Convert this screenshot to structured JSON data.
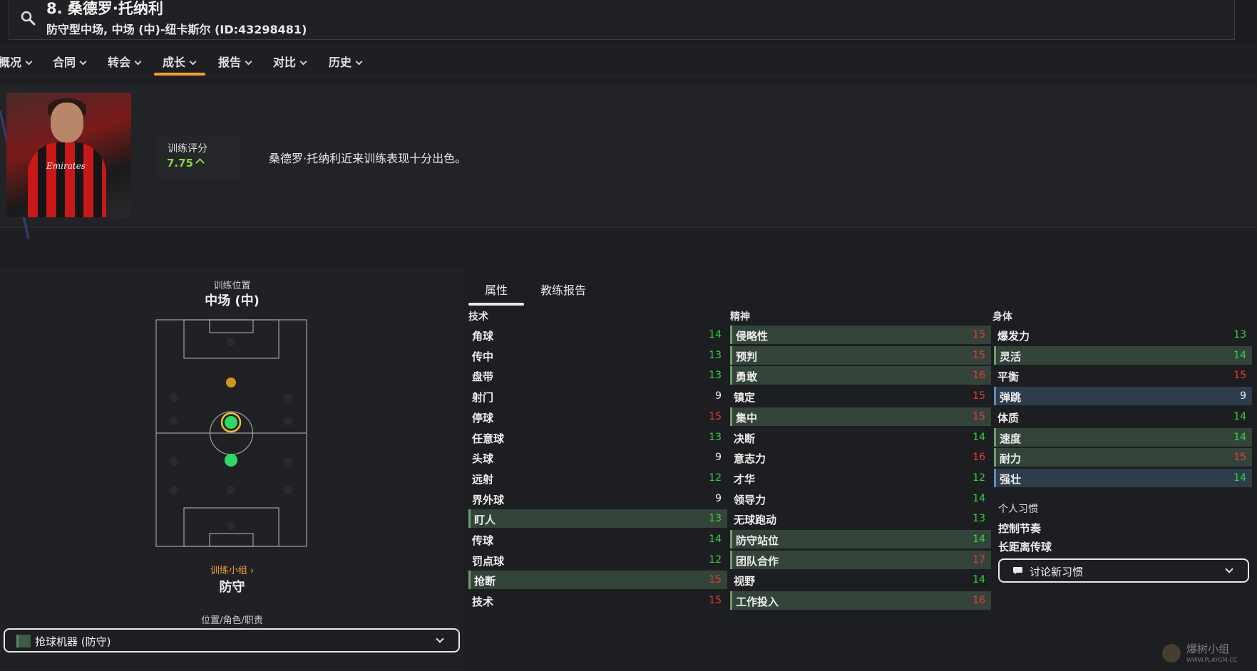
{
  "header": {
    "player_name": "8. 桑德罗·托纳利",
    "player_sub": "防守型中场, 中场 (中)-纽卡斯尔 (ID:43298481)"
  },
  "nav": {
    "tabs": [
      {
        "label": "概况"
      },
      {
        "label": "合同"
      },
      {
        "label": "转会"
      },
      {
        "label": "成长",
        "active": true
      },
      {
        "label": "报告"
      },
      {
        "label": "对比"
      },
      {
        "label": "历史"
      }
    ]
  },
  "training": {
    "photo_sponsor": "Emirates",
    "rating_label": "训练评分",
    "rating_value": "7.75",
    "comment": "桑德罗·托纳利近来训练表现十分出色。"
  },
  "position": {
    "label": "训练位置",
    "value": "中场 (中)",
    "group_link": "训练小组",
    "group_value": "防守",
    "role_label": "位置/角色/职责",
    "role_value": "抢球机器 (防守)"
  },
  "attr_tabs": [
    {
      "label": "属性",
      "active": true
    },
    {
      "label": "教练报告"
    }
  ],
  "attributes": {
    "technical": {
      "title": "技术",
      "rows": [
        {
          "name": "角球",
          "value": "14",
          "color": "green"
        },
        {
          "name": "传中",
          "value": "13",
          "color": "green"
        },
        {
          "name": "盘带",
          "value": "13",
          "color": "green"
        },
        {
          "name": "射门",
          "value": "9",
          "color": "white"
        },
        {
          "name": "停球",
          "value": "15",
          "color": "red"
        },
        {
          "name": "任意球",
          "value": "13",
          "color": "green"
        },
        {
          "name": "头球",
          "value": "9",
          "color": "white"
        },
        {
          "name": "远射",
          "value": "12",
          "color": "green"
        },
        {
          "name": "界外球",
          "value": "9",
          "color": "white"
        },
        {
          "name": "盯人",
          "value": "13",
          "color": "green",
          "highlight": "green"
        },
        {
          "name": "传球",
          "value": "14",
          "color": "green"
        },
        {
          "name": "罚点球",
          "value": "12",
          "color": "green"
        },
        {
          "name": "抢断",
          "value": "15",
          "color": "red",
          "highlight": "green"
        },
        {
          "name": "技术",
          "value": "15",
          "color": "red"
        }
      ]
    },
    "mental": {
      "title": "精神",
      "rows": [
        {
          "name": "侵略性",
          "value": "15",
          "color": "red",
          "highlight": "green"
        },
        {
          "name": "预判",
          "value": "15",
          "color": "red",
          "highlight": "green"
        },
        {
          "name": "勇敢",
          "value": "16",
          "color": "red",
          "highlight": "green"
        },
        {
          "name": "镇定",
          "value": "15",
          "color": "red"
        },
        {
          "name": "集中",
          "value": "15",
          "color": "red",
          "highlight": "green"
        },
        {
          "name": "决断",
          "value": "14",
          "color": "green"
        },
        {
          "name": "意志力",
          "value": "16",
          "color": "red"
        },
        {
          "name": "才华",
          "value": "12",
          "color": "green"
        },
        {
          "name": "领导力",
          "value": "14",
          "color": "green"
        },
        {
          "name": "无球跑动",
          "value": "13",
          "color": "green"
        },
        {
          "name": "防守站位",
          "value": "14",
          "color": "green",
          "highlight": "green"
        },
        {
          "name": "团队合作",
          "value": "17",
          "color": "red",
          "highlight": "green"
        },
        {
          "name": "视野",
          "value": "14",
          "color": "green"
        },
        {
          "name": "工作投入",
          "value": "16",
          "color": "red",
          "highlight": "green"
        }
      ]
    },
    "physical": {
      "title": "身体",
      "rows": [
        {
          "name": "爆发力",
          "value": "13",
          "color": "green"
        },
        {
          "name": "灵活",
          "value": "14",
          "color": "green",
          "highlight": "green"
        },
        {
          "name": "平衡",
          "value": "15",
          "color": "red"
        },
        {
          "name": "弹跳",
          "value": "9",
          "color": "white",
          "highlight": "blue"
        },
        {
          "name": "体质",
          "value": "14",
          "color": "green"
        },
        {
          "name": "速度",
          "value": "14",
          "color": "green",
          "highlight": "green"
        },
        {
          "name": "耐力",
          "value": "15",
          "color": "red",
          "highlight": "green"
        },
        {
          "name": "强壮",
          "value": "14",
          "color": "green",
          "highlight": "blue"
        }
      ]
    }
  },
  "habits": {
    "title": "个人习惯",
    "items": [
      "控制节奏",
      "长距离传球"
    ],
    "discuss_button": "讨论新习惯"
  },
  "watermark": {
    "text": "爆树小组",
    "url": "WWW.PLAYGM.CC"
  },
  "colors": {
    "accent": "#f0a030",
    "value_green": "#35d040",
    "value_red": "#e83a3a",
    "highlight_green": "#34443a",
    "highlight_blue": "#2e3d4c",
    "rating_green": "#8ed43c"
  }
}
